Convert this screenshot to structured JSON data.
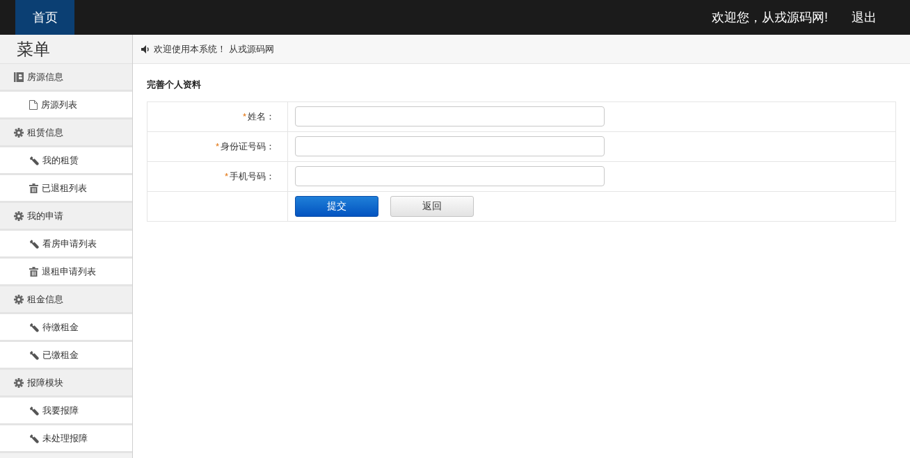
{
  "top_bar": {
    "home_tab": {
      "label": "首页",
      "selected": true
    },
    "welcome": "欢迎您，从戎源码网!",
    "logout": "退出"
  },
  "sidebar": {
    "title": "菜单",
    "groups": [
      {
        "label": "房源信息",
        "kind": "book",
        "children": [
          {
            "label": "房源列表",
            "kind": "file"
          }
        ]
      },
      {
        "label": "租赁信息",
        "kind": "gear",
        "children": [
          {
            "label": "我的租赁",
            "kind": "wrench"
          },
          {
            "label": "已退租列表",
            "kind": "trash"
          }
        ]
      },
      {
        "label": "我的申请",
        "kind": "gear",
        "children": [
          {
            "label": "看房申请列表",
            "kind": "wrench"
          },
          {
            "label": "退租申请列表",
            "kind": "trash"
          }
        ]
      },
      {
        "label": "租金信息",
        "kind": "gear",
        "children": [
          {
            "label": "待缴租金",
            "kind": "wrench"
          },
          {
            "label": "已缴租金",
            "kind": "wrench"
          }
        ]
      },
      {
        "label": "报障模块",
        "kind": "gear",
        "children": [
          {
            "label": "我要报障",
            "kind": "wrench"
          },
          {
            "label": "未处理报障",
            "kind": "wrench"
          }
        ]
      }
    ]
  },
  "notice": "欢迎使用本系统！ 从戎源码网",
  "form": {
    "title": "完善个人资料",
    "fields": [
      {
        "marker": "*",
        "label": "姓名："
      },
      {
        "marker": "*",
        "label": "身份证号码："
      },
      {
        "marker": "*",
        "label": "手机号码："
      }
    ],
    "buttons": [
      {
        "label": "提交",
        "kind": "primary"
      },
      {
        "label": "返回",
        "kind": "secondary"
      }
    ]
  }
}
